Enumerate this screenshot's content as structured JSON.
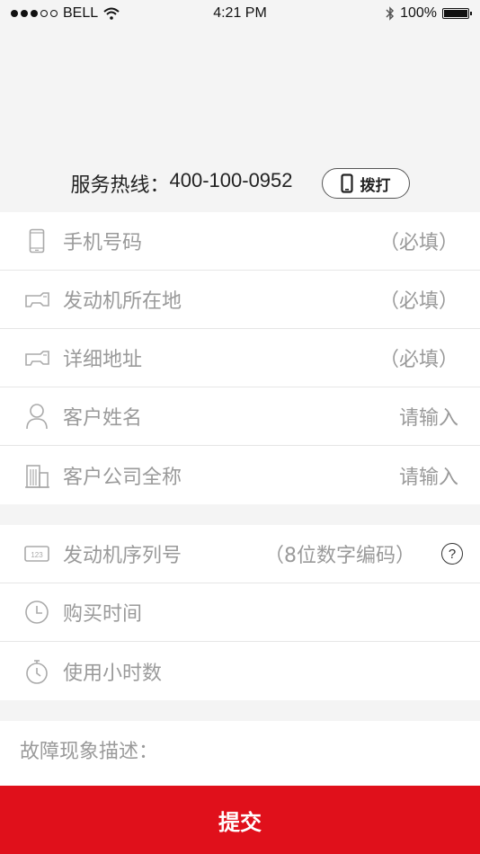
{
  "status_bar": {
    "carrier": "BELL",
    "time": "4:21 PM",
    "battery": "100%",
    "battery_level": 1.0
  },
  "hotline": {
    "label": "服务热线：",
    "number": "400-100-0952",
    "call_button": "拨打"
  },
  "form": {
    "group1": [
      {
        "icon": "phone-icon",
        "label": "手机号码",
        "hint": "（必填）"
      },
      {
        "icon": "engine-icon",
        "label": "发动机所在地",
        "hint": "（必填）"
      },
      {
        "icon": "engine-icon",
        "label": "详细地址",
        "hint": "（必填）"
      },
      {
        "icon": "person-icon",
        "label": "客户姓名",
        "hint": "请输入"
      },
      {
        "icon": "building-icon",
        "label": "客户公司全称",
        "hint": "请输入"
      }
    ],
    "group2": [
      {
        "icon": "serial-number-icon",
        "label": "发动机序列号",
        "hint": "（8位数字编码）",
        "help": "?"
      },
      {
        "icon": "clock-icon",
        "label": "购买时间",
        "hint": ""
      },
      {
        "icon": "stopwatch-icon",
        "label": "使用小时数",
        "hint": ""
      }
    ]
  },
  "description": {
    "label": "故障现象描述："
  },
  "submit_label": "提交"
}
